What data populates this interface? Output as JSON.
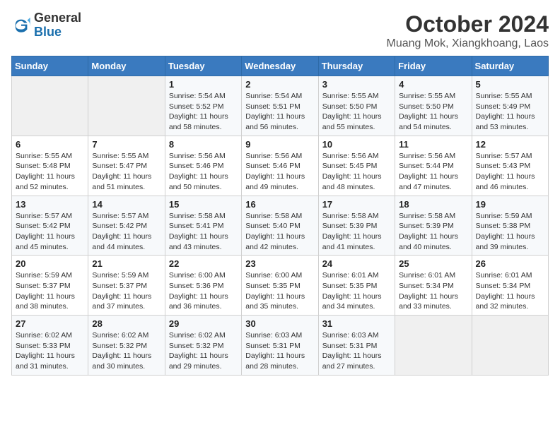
{
  "logo": {
    "general": "General",
    "blue": "Blue"
  },
  "title": "October 2024",
  "subtitle": "Muang Mok, Xiangkhoang, Laos",
  "days_header": [
    "Sunday",
    "Monday",
    "Tuesday",
    "Wednesday",
    "Thursday",
    "Friday",
    "Saturday"
  ],
  "weeks": [
    [
      {
        "day": "",
        "sunrise": "",
        "sunset": "",
        "daylight": ""
      },
      {
        "day": "",
        "sunrise": "",
        "sunset": "",
        "daylight": ""
      },
      {
        "day": "1",
        "sunrise": "Sunrise: 5:54 AM",
        "sunset": "Sunset: 5:52 PM",
        "daylight": "Daylight: 11 hours and 58 minutes."
      },
      {
        "day": "2",
        "sunrise": "Sunrise: 5:54 AM",
        "sunset": "Sunset: 5:51 PM",
        "daylight": "Daylight: 11 hours and 56 minutes."
      },
      {
        "day": "3",
        "sunrise": "Sunrise: 5:55 AM",
        "sunset": "Sunset: 5:50 PM",
        "daylight": "Daylight: 11 hours and 55 minutes."
      },
      {
        "day": "4",
        "sunrise": "Sunrise: 5:55 AM",
        "sunset": "Sunset: 5:50 PM",
        "daylight": "Daylight: 11 hours and 54 minutes."
      },
      {
        "day": "5",
        "sunrise": "Sunrise: 5:55 AM",
        "sunset": "Sunset: 5:49 PM",
        "daylight": "Daylight: 11 hours and 53 minutes."
      }
    ],
    [
      {
        "day": "6",
        "sunrise": "Sunrise: 5:55 AM",
        "sunset": "Sunset: 5:48 PM",
        "daylight": "Daylight: 11 hours and 52 minutes."
      },
      {
        "day": "7",
        "sunrise": "Sunrise: 5:55 AM",
        "sunset": "Sunset: 5:47 PM",
        "daylight": "Daylight: 11 hours and 51 minutes."
      },
      {
        "day": "8",
        "sunrise": "Sunrise: 5:56 AM",
        "sunset": "Sunset: 5:46 PM",
        "daylight": "Daylight: 11 hours and 50 minutes."
      },
      {
        "day": "9",
        "sunrise": "Sunrise: 5:56 AM",
        "sunset": "Sunset: 5:46 PM",
        "daylight": "Daylight: 11 hours and 49 minutes."
      },
      {
        "day": "10",
        "sunrise": "Sunrise: 5:56 AM",
        "sunset": "Sunset: 5:45 PM",
        "daylight": "Daylight: 11 hours and 48 minutes."
      },
      {
        "day": "11",
        "sunrise": "Sunrise: 5:56 AM",
        "sunset": "Sunset: 5:44 PM",
        "daylight": "Daylight: 11 hours and 47 minutes."
      },
      {
        "day": "12",
        "sunrise": "Sunrise: 5:57 AM",
        "sunset": "Sunset: 5:43 PM",
        "daylight": "Daylight: 11 hours and 46 minutes."
      }
    ],
    [
      {
        "day": "13",
        "sunrise": "Sunrise: 5:57 AM",
        "sunset": "Sunset: 5:42 PM",
        "daylight": "Daylight: 11 hours and 45 minutes."
      },
      {
        "day": "14",
        "sunrise": "Sunrise: 5:57 AM",
        "sunset": "Sunset: 5:42 PM",
        "daylight": "Daylight: 11 hours and 44 minutes."
      },
      {
        "day": "15",
        "sunrise": "Sunrise: 5:58 AM",
        "sunset": "Sunset: 5:41 PM",
        "daylight": "Daylight: 11 hours and 43 minutes."
      },
      {
        "day": "16",
        "sunrise": "Sunrise: 5:58 AM",
        "sunset": "Sunset: 5:40 PM",
        "daylight": "Daylight: 11 hours and 42 minutes."
      },
      {
        "day": "17",
        "sunrise": "Sunrise: 5:58 AM",
        "sunset": "Sunset: 5:39 PM",
        "daylight": "Daylight: 11 hours and 41 minutes."
      },
      {
        "day": "18",
        "sunrise": "Sunrise: 5:58 AM",
        "sunset": "Sunset: 5:39 PM",
        "daylight": "Daylight: 11 hours and 40 minutes."
      },
      {
        "day": "19",
        "sunrise": "Sunrise: 5:59 AM",
        "sunset": "Sunset: 5:38 PM",
        "daylight": "Daylight: 11 hours and 39 minutes."
      }
    ],
    [
      {
        "day": "20",
        "sunrise": "Sunrise: 5:59 AM",
        "sunset": "Sunset: 5:37 PM",
        "daylight": "Daylight: 11 hours and 38 minutes."
      },
      {
        "day": "21",
        "sunrise": "Sunrise: 5:59 AM",
        "sunset": "Sunset: 5:37 PM",
        "daylight": "Daylight: 11 hours and 37 minutes."
      },
      {
        "day": "22",
        "sunrise": "Sunrise: 6:00 AM",
        "sunset": "Sunset: 5:36 PM",
        "daylight": "Daylight: 11 hours and 36 minutes."
      },
      {
        "day": "23",
        "sunrise": "Sunrise: 6:00 AM",
        "sunset": "Sunset: 5:35 PM",
        "daylight": "Daylight: 11 hours and 35 minutes."
      },
      {
        "day": "24",
        "sunrise": "Sunrise: 6:01 AM",
        "sunset": "Sunset: 5:35 PM",
        "daylight": "Daylight: 11 hours and 34 minutes."
      },
      {
        "day": "25",
        "sunrise": "Sunrise: 6:01 AM",
        "sunset": "Sunset: 5:34 PM",
        "daylight": "Daylight: 11 hours and 33 minutes."
      },
      {
        "day": "26",
        "sunrise": "Sunrise: 6:01 AM",
        "sunset": "Sunset: 5:34 PM",
        "daylight": "Daylight: 11 hours and 32 minutes."
      }
    ],
    [
      {
        "day": "27",
        "sunrise": "Sunrise: 6:02 AM",
        "sunset": "Sunset: 5:33 PM",
        "daylight": "Daylight: 11 hours and 31 minutes."
      },
      {
        "day": "28",
        "sunrise": "Sunrise: 6:02 AM",
        "sunset": "Sunset: 5:32 PM",
        "daylight": "Daylight: 11 hours and 30 minutes."
      },
      {
        "day": "29",
        "sunrise": "Sunrise: 6:02 AM",
        "sunset": "Sunset: 5:32 PM",
        "daylight": "Daylight: 11 hours and 29 minutes."
      },
      {
        "day": "30",
        "sunrise": "Sunrise: 6:03 AM",
        "sunset": "Sunset: 5:31 PM",
        "daylight": "Daylight: 11 hours and 28 minutes."
      },
      {
        "day": "31",
        "sunrise": "Sunrise: 6:03 AM",
        "sunset": "Sunset: 5:31 PM",
        "daylight": "Daylight: 11 hours and 27 minutes."
      },
      {
        "day": "",
        "sunrise": "",
        "sunset": "",
        "daylight": ""
      },
      {
        "day": "",
        "sunrise": "",
        "sunset": "",
        "daylight": ""
      }
    ]
  ]
}
